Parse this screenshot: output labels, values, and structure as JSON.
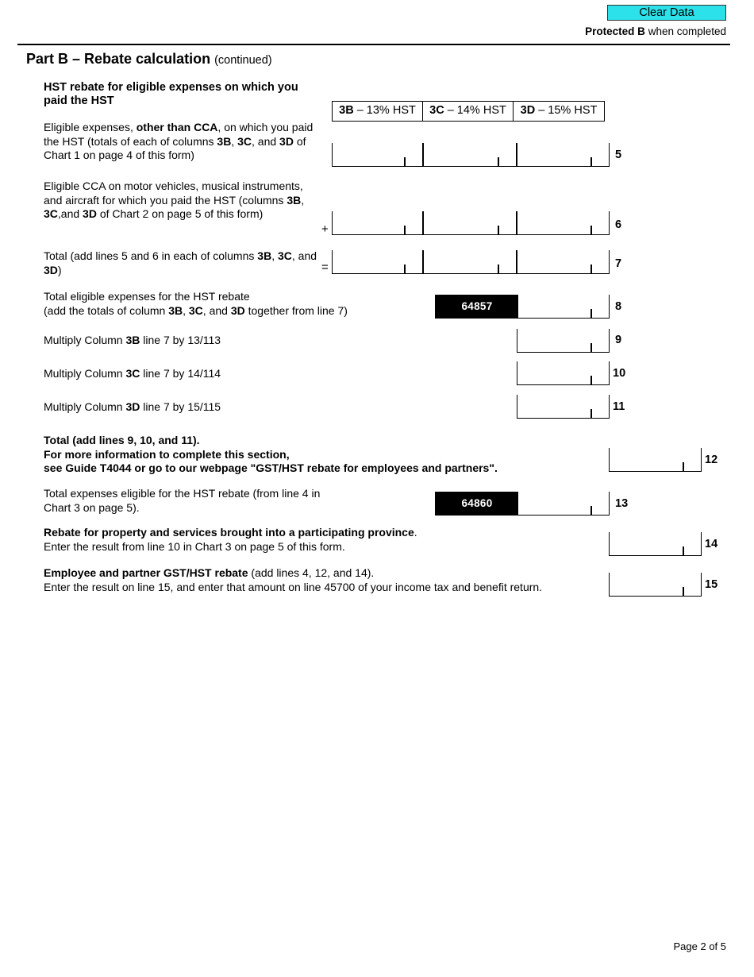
{
  "header": {
    "clear_data_label": "Clear Data",
    "protected_bold": "Protected B",
    "protected_rest": " when completed"
  },
  "part": {
    "title": "Part B – Rebate calculation",
    "continued": "(continued)"
  },
  "section": {
    "title": "HST rebate for eligible expenses on which you paid the HST"
  },
  "columns": [
    {
      "code": "3B",
      "rate": "– 13% HST"
    },
    {
      "code": "3C",
      "rate": "– 14% HST"
    },
    {
      "code": "3D",
      "rate": "– 15% HST"
    }
  ],
  "rows": {
    "line5": {
      "number": "5",
      "text_html": "Eligible expenses, <b>other than CCA</b>, on which you paid the HST (totals of each of columns <b>3B</b>, <b>3C</b>, and <b>3D</b> of Chart 1 on page 4 of this form)",
      "operator": ""
    },
    "line6": {
      "number": "6",
      "text_html": "Eligible CCA on motor vehicles, musical instruments, and aircraft for which you paid the HST (columns <b>3B</b>, <b>3C</b>,and <b>3D</b> of Chart 2 on page 5 of this form)",
      "operator": "+"
    },
    "line7": {
      "number": "7",
      "text_html": "Total (add lines 5 and 6 in each of columns <b>3B</b>, <b>3C</b>, and <b>3D</b>)",
      "operator": "="
    },
    "line8": {
      "number": "8",
      "text_html": "Total eligible expenses for the HST rebate<br>(add the totals of column <b>3B</b>, <b>3C</b>, and <b>3D</b> together from line 7)",
      "box_code": "64857",
      "value": ""
    },
    "line9": {
      "number": "9",
      "text_html": "Multiply Column <b>3B</b> line 7 by 13/113",
      "value": ""
    },
    "line10": {
      "number": "10",
      "text_html": "Multiply Column <b>3C</b> line 7 by 14/114",
      "value": ""
    },
    "line11": {
      "number": "11",
      "text_html": "Multiply Column <b>3D</b> line 7 by 15/115",
      "value": ""
    },
    "line12": {
      "number": "12",
      "text_html": "<b>Total (add lines 9, 10, and 11).<br>For more information to complete this section,<br>see Guide T4044 or go to our webpage \"GST/HST rebate for employees and partners\".</b>",
      "value": ""
    },
    "line13": {
      "number": "13",
      "text_html": "Total expenses eligible for the HST rebate (from line 4 in<br>Chart 3 on page 5).",
      "box_code": "64860",
      "value": ""
    },
    "line14": {
      "number": "14",
      "text_html": "<b>Rebate for property and services brought into a participating province</b>.<br>Enter the result from line 10 in Chart 3 on page 5 of this form.",
      "value": ""
    },
    "line15": {
      "number": "15",
      "text_html": "<b>Employee and partner GST/HST rebate</b> (add lines 4, 12, and 14).<br>Enter the result on line 15, and enter that amount on line 45700 of your income tax and benefit return.",
      "value": ""
    }
  },
  "footer": {
    "page_label": "Page 2 of 5"
  },
  "colors": {
    "clear_data_fill": "#2ce1ea",
    "rule": "#000000",
    "filled_box": "#000000"
  }
}
